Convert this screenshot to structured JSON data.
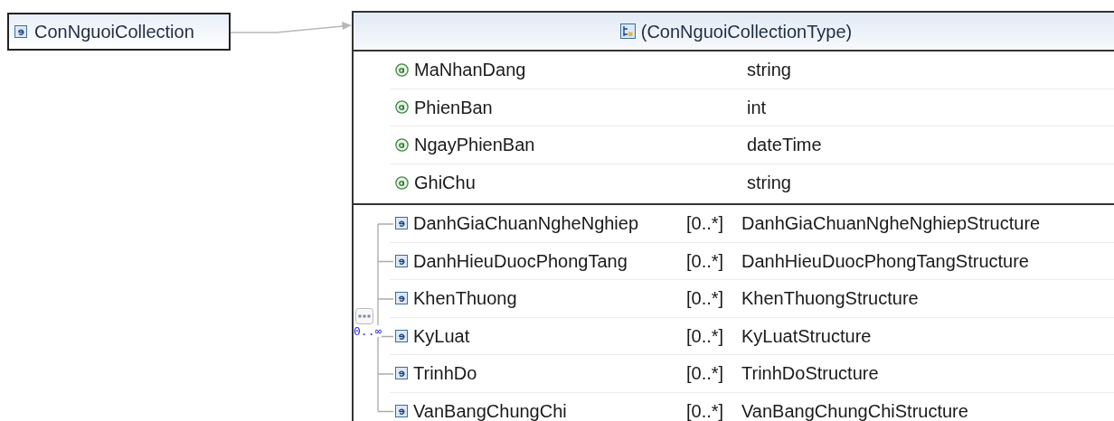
{
  "root_element": {
    "name": "ConNguoiCollection"
  },
  "type": {
    "title": "(ConNguoiCollectionType)",
    "attributes": [
      {
        "name": "MaNhanDang",
        "type": "string"
      },
      {
        "name": "PhienBan",
        "type": "int"
      },
      {
        "name": "NgayPhienBan",
        "type": "dateTime"
      },
      {
        "name": "GhiChu",
        "type": "string"
      }
    ],
    "sequence": {
      "multiplicity": "0..∞"
    },
    "elements": [
      {
        "name": "DanhGiaChuanNgheNghiep",
        "multiplicity": "[0..*]",
        "type": "DanhGiaChuanNgheNghiepStructure"
      },
      {
        "name": "DanhHieuDuocPhongTang",
        "multiplicity": "[0..*]",
        "type": "DanhHieuDuocPhongTangStructure"
      },
      {
        "name": "KhenThuong",
        "multiplicity": "[0..*]",
        "type": "KhenThuongStructure"
      },
      {
        "name": "KyLuat",
        "multiplicity": "[0..*]",
        "type": "KyLuatStructure"
      },
      {
        "name": "TrinhDo",
        "multiplicity": "[0..*]",
        "type": "TrinhDoStructure"
      },
      {
        "name": "VanBangChungChi",
        "multiplicity": "[0..*]",
        "type": "VanBangChungChiStructure"
      }
    ]
  }
}
